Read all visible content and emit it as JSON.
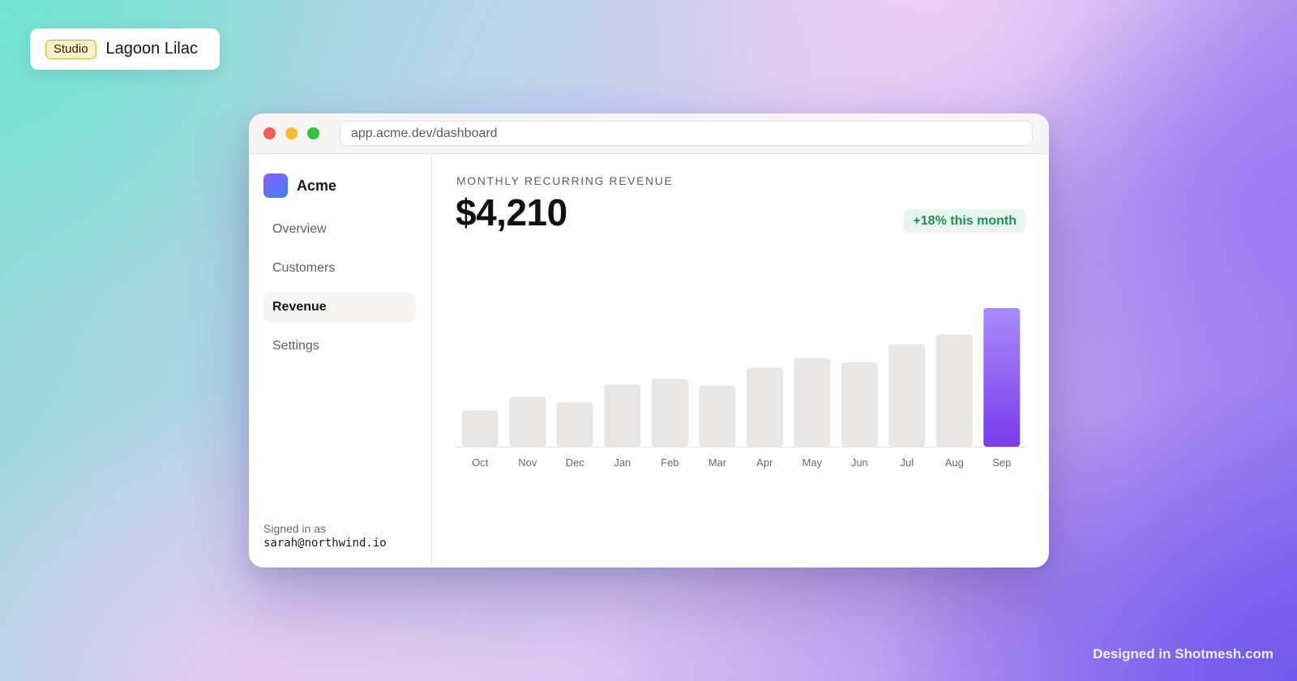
{
  "studio": {
    "badge": "Studio",
    "title": "Lagoon Lilac"
  },
  "browser": {
    "url": "app.acme.dev/dashboard"
  },
  "sidebar": {
    "brand": "Acme",
    "items": [
      {
        "label": "Overview",
        "active": false
      },
      {
        "label": "Customers",
        "active": false
      },
      {
        "label": "Revenue",
        "active": true
      },
      {
        "label": "Settings",
        "active": false
      }
    ],
    "signed_in_label": "Signed in as",
    "signed_in_email": "sarah@northwind.io"
  },
  "main": {
    "metric_label": "MONTHLY RECURRING REVENUE",
    "metric_value": "$4,210",
    "delta": "+18% this month"
  },
  "chart_data": {
    "type": "bar",
    "categories": [
      "Oct",
      "Nov",
      "Dec",
      "Jan",
      "Feb",
      "Mar",
      "Apr",
      "May",
      "Jun",
      "Jul",
      "Aug",
      "Sep"
    ],
    "values": [
      26,
      36,
      32,
      45,
      49,
      44,
      57,
      64,
      61,
      74,
      81,
      100
    ],
    "highlight_index": 11,
    "ylim": [
      0,
      100
    ],
    "grid": false,
    "colors": {
      "bar": "#e8e7e5",
      "highlight_top": "#a78bfa",
      "highlight_bottom": "#7c3aed",
      "baseline": "#e3e2df"
    }
  },
  "credit": "Designed in Shotmesh.com",
  "colors": {
    "accent": "#7c3aed",
    "positive": "#1f8f53"
  }
}
